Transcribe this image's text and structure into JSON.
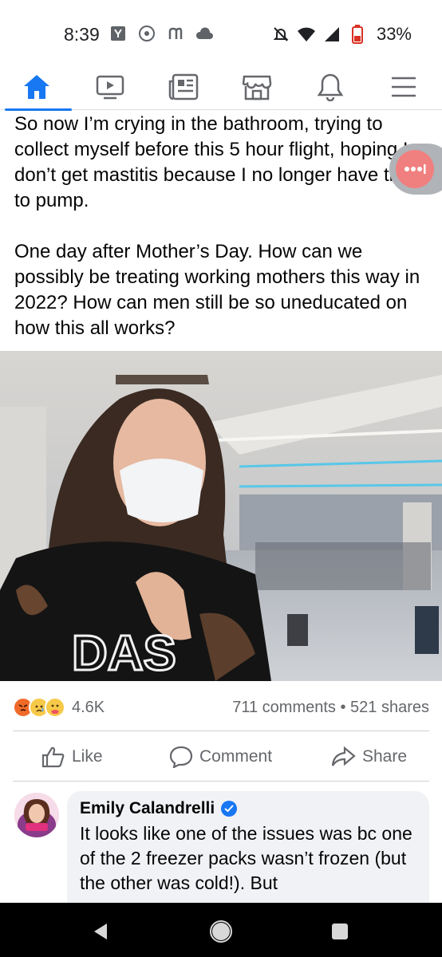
{
  "status_bar": {
    "time": "8:39",
    "battery": "33%"
  },
  "nav": {
    "items": [
      {
        "name": "home-icon",
        "active": true
      },
      {
        "name": "video-icon"
      },
      {
        "name": "news-icon"
      },
      {
        "name": "marketplace-icon"
      },
      {
        "name": "bell-icon"
      },
      {
        "name": "menu-icon"
      }
    ],
    "accent": "#1877f2"
  },
  "post": {
    "paragraph_1": "So now I’m crying in the bathroom, trying to collect myself before this 5 hour flight, hoping I don’t get mastitis because I no longer have time to pump.",
    "paragraph_2": "One day after Mother’s Day. How can we possibly be treating working mothers this way in 2022? How can men still be so uneducated on how this all works?",
    "photo_shirt_text": "DAS"
  },
  "engagement": {
    "reaction_count": "4.6K",
    "stats": "711 comments • 521 shares"
  },
  "actions": {
    "like": "Like",
    "comment": "Comment",
    "share": "Share"
  },
  "comment": {
    "author": "Emily Calandrelli",
    "text": "It looks like one of the issues was bc one of the 2 freezer packs wasn’t frozen (but the other was cold!). But"
  }
}
